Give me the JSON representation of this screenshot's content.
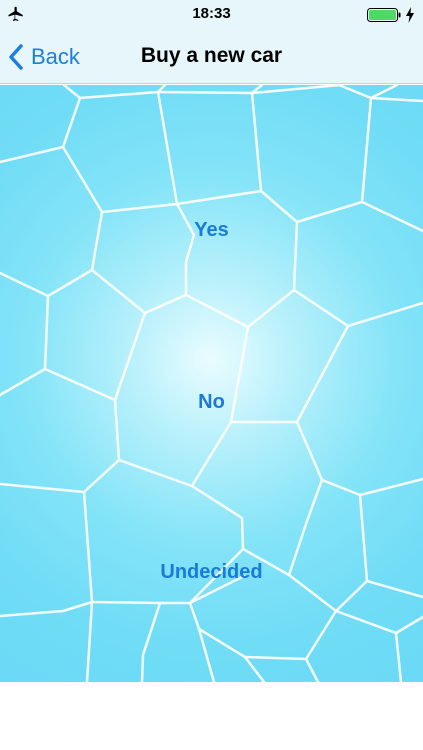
{
  "status_bar": {
    "time": "18:33",
    "left_icon": "airplane-icon",
    "battery_icon": "battery-icon",
    "charging_icon": "bolt-icon"
  },
  "nav": {
    "back_label": "Back",
    "back_icon": "chevron-left-icon",
    "title": "Buy a new car"
  },
  "options": {
    "yes": "Yes",
    "no": "No",
    "undecided": "Undecided"
  },
  "colors": {
    "accent": "#1a7fe0",
    "bar_background": "#e6f6fb",
    "cell_background": "#70dcf6",
    "cell_lines": "#ffffff"
  }
}
